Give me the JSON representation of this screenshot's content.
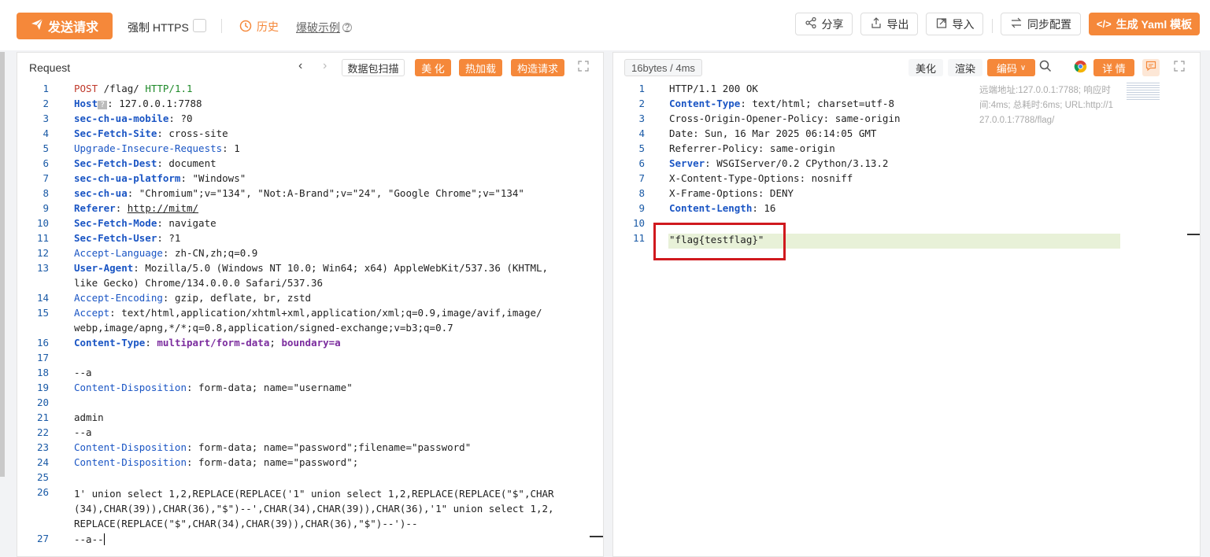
{
  "toolbar": {
    "send_label": "发送请求",
    "https_label": "强制 HTTPS",
    "history_label": "历史",
    "example_label": "爆破示例",
    "share_label": "分享",
    "export_label": "导出",
    "import_label": "导入",
    "sync_label": "同步配置",
    "yaml_label": "生成 Yaml 模板"
  },
  "request": {
    "title": "Request",
    "scan_label": "数据包扫描",
    "beautify_label": "美 化",
    "hotload_label": "热加载",
    "construct_label": "构造请求",
    "line_numbers": [
      "1",
      "2",
      "3",
      "4",
      "5",
      "6",
      "7",
      "8",
      "9",
      "10",
      "11",
      "12",
      "13",
      "",
      "14",
      "15",
      "",
      "16",
      "17",
      "18",
      "19",
      "20",
      "21",
      "22",
      "23",
      "24",
      "25",
      "26",
      "",
      "",
      "27"
    ]
  },
  "response": {
    "size_label": "16bytes / 4ms",
    "beautify_label": "美化",
    "render_label": "渲染",
    "encode_label": "编码",
    "detail_label": "详 情",
    "remote_info_1": "远端地址:127.0.0.1:7788; 响应时",
    "remote_info_2": "间:4ms; 总耗时:6ms; URL:http://1",
    "remote_info_3": "27.0.0.1:7788/flag/",
    "line_numbers": [
      "1",
      "2",
      "3",
      "4",
      "5",
      "6",
      "7",
      "8",
      "9",
      "10",
      "11"
    ],
    "flag_line": "\"flag{testflag}\""
  },
  "colors": {
    "accent": "#f5883a",
    "highlight": "#e8f1d8",
    "box": "#d0191e"
  }
}
